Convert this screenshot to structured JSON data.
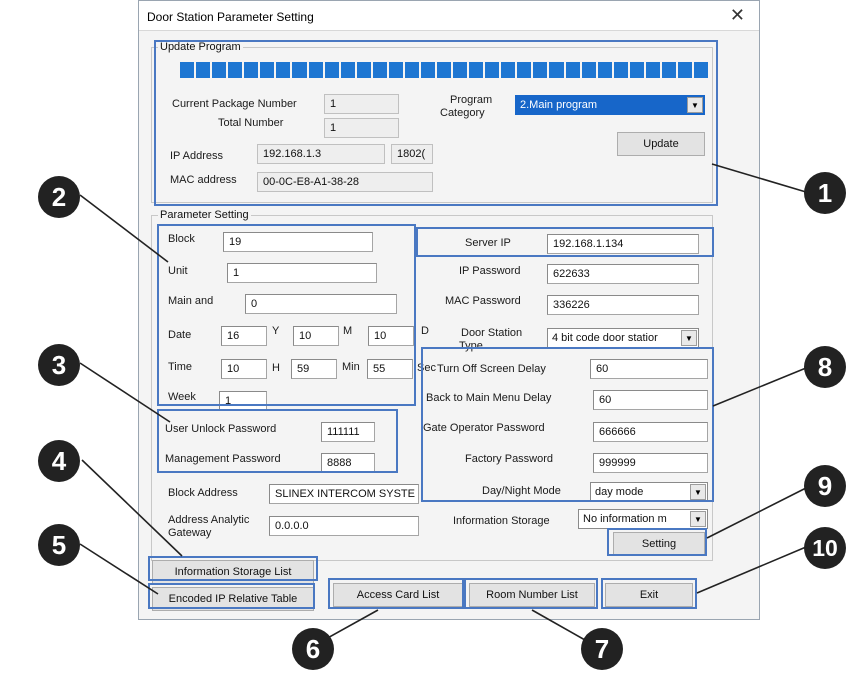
{
  "window": {
    "title": "Door Station Parameter Setting",
    "close_label": "✕"
  },
  "update_program": {
    "legend": "Update Program",
    "progress_percent": 100,
    "current_package_label": "Current Package Number",
    "current_package_value": "1",
    "total_number_label": "Total Number",
    "total_number_value": "1",
    "program_category_label_1": "Program",
    "program_category_label_2": "Category",
    "program_category_value": "2.Main program",
    "ip_address_label": "IP Address",
    "ip_address_value": "192.168.1.3",
    "port_value": "1802(",
    "mac_address_label": "MAC address",
    "mac_address_value": "00-0C-E8-A1-38-28",
    "update_button": "Update"
  },
  "parameter_setting": {
    "legend": "Parameter Setting",
    "block_label": "Block",
    "block_value": "19",
    "unit_label": "Unit",
    "unit_value": "1",
    "main_and_label": "Main and",
    "main_and_value": "0",
    "date_label": "Date",
    "date_day": "16",
    "date_y_label": "Y",
    "date_month": "10",
    "date_m_label": "M",
    "date_year": "10",
    "date_d_label": "D",
    "time_label": "Time",
    "time_hour": "10",
    "time_h_label": "H",
    "time_min": "59",
    "time_min_label": "Min",
    "time_sec": "55",
    "time_sec_label": "Sec",
    "week_label": "Week",
    "week_value": "1",
    "server_ip_label": "Server IP",
    "server_ip_value": "192.168.1.134",
    "ip_password_label": "IP Password",
    "ip_password_value": "622633",
    "mac_password_label": "MAC Password",
    "mac_password_value": "336226",
    "door_station_type_label_1": "Door Station",
    "door_station_type_label_2": "Type",
    "door_station_type_value": "4 bit code door statior",
    "user_unlock_label": "User Unlock Password",
    "user_unlock_value": "111111",
    "management_label": "Management Password",
    "management_value": "8888",
    "turn_off_label": "Turn Off Screen Delay",
    "turn_off_value": "60",
    "back_menu_label": "Back to Main Menu Delay",
    "back_menu_value": "60",
    "gate_label": "Gate Operator Password",
    "gate_value": "666666",
    "factory_label": "Factory Password",
    "factory_value": "999999",
    "day_night_label": "Day/Night Mode",
    "day_night_value": "day mode",
    "block_address_label": "Block Address",
    "block_address_value": "SLINEX INTERCOM SYSTE",
    "gateway_label_1": "Address Analytic",
    "gateway_label_2": "Gateway",
    "gateway_value": "0.0.0.0",
    "info_storage_label": "Information Storage",
    "info_storage_value": "No information m",
    "setting_button": "Setting"
  },
  "buttons": {
    "info_storage_list": "Information Storage List",
    "encoded_ip_table": "Encoded IP Relative Table",
    "access_card_list": "Access Card List",
    "room_number_list": "Room Number List",
    "exit": "Exit"
  },
  "callouts": [
    "1",
    "2",
    "3",
    "4",
    "5",
    "6",
    "7",
    "8",
    "9",
    "10"
  ],
  "colors": {
    "callout_box": "#4a78c2",
    "progress": "#1d76d2",
    "badge": "#222222",
    "selected_dropdown": "#1766c9"
  }
}
